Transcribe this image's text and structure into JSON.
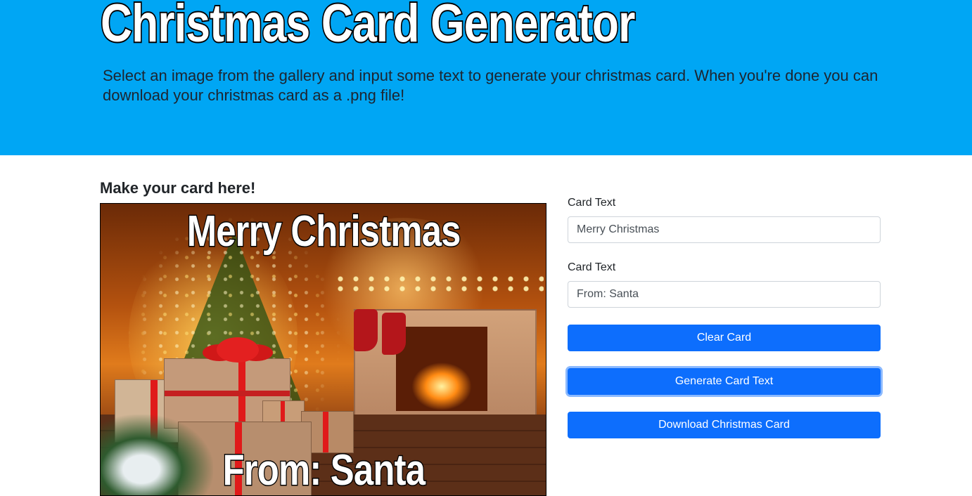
{
  "header": {
    "title": "Christmas Card Generator",
    "description": "Select an image from the gallery and input some text to generate your christmas card. When you're done you can download your christmas card as a .png file!",
    "background_color": "#00a6f4"
  },
  "main": {
    "heading": "Make your card here!",
    "card_preview": {
      "top_text": "Merry Christmas",
      "bottom_text": "From: Santa"
    },
    "form": {
      "field1": {
        "label": "Card Text",
        "value": "Merry Christmas"
      },
      "field2": {
        "label": "Card Text",
        "value": "From: Santa"
      },
      "clear_button": "Clear Card",
      "generate_button": "Generate Card Text",
      "download_button": "Download Christmas Card",
      "button_color": "#0d6efd"
    }
  }
}
